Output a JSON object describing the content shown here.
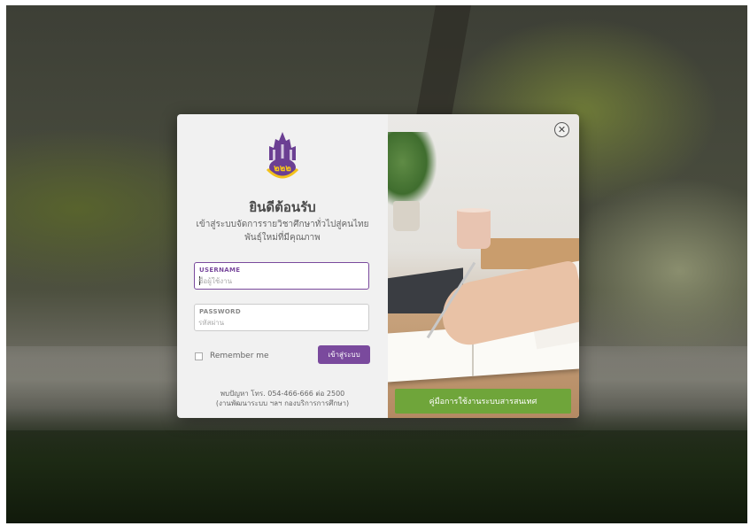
{
  "login": {
    "title": "ยินดีต้อนรับ",
    "subtitle_line1": "เข้าสู่ระบบจัดการรายวิชาศึกษาทั่วไปสู่คนไทย",
    "subtitle_line2": "พันธุ์ใหม่ที่มีคุณภาพ",
    "username_label": "USERNAME",
    "username_placeholder": "ชื่อผู้ใช้งาน",
    "password_label": "PASSWORD",
    "password_placeholder": "รหัสผ่าน",
    "remember_label": "Remember me",
    "login_button": "เข้าสู่ระบบ",
    "contact_line1": "พบปัญหา โทร. 054-466-666 ต่อ 2500",
    "contact_line2": "(งานพัฒนาระบบ ฯลฯ กองบริการการศึกษา)"
  },
  "right_panel": {
    "manual_button": "คู่มือการใช้งานระบบสารสนเทศ",
    "close_symbol": "✕"
  },
  "colors": {
    "accent_purple": "#7a4a9d",
    "manual_green": "#6fa53a"
  },
  "icons": {
    "logo": "university-logo",
    "close": "close-icon"
  }
}
